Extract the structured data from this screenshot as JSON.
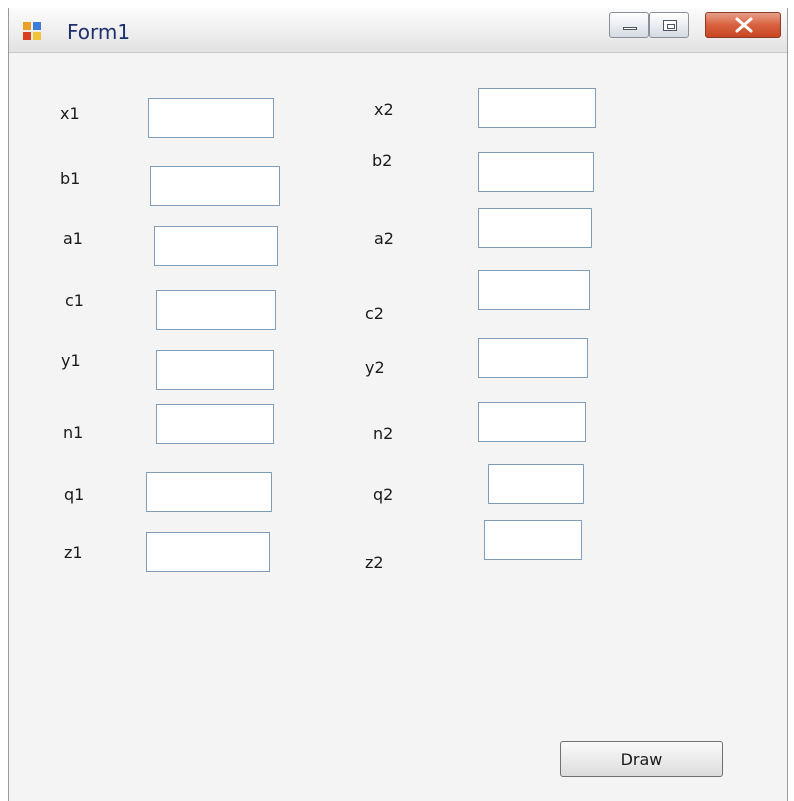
{
  "window": {
    "title": "Form1"
  },
  "fields": {
    "x1": {
      "label": "x1",
      "value": ""
    },
    "b1": {
      "label": "b1",
      "value": ""
    },
    "a1": {
      "label": "a1",
      "value": ""
    },
    "c1": {
      "label": "c1",
      "value": ""
    },
    "y1": {
      "label": "y1",
      "value": ""
    },
    "n1": {
      "label": "n1",
      "value": ""
    },
    "q1": {
      "label": "q1",
      "value": ""
    },
    "z1": {
      "label": "z1",
      "value": ""
    },
    "x2": {
      "label": "x2",
      "value": ""
    },
    "b2": {
      "label": "b2",
      "value": ""
    },
    "a2": {
      "label": "a2",
      "value": ""
    },
    "c2": {
      "label": "c2",
      "value": ""
    },
    "y2": {
      "label": "y2",
      "value": ""
    },
    "n2": {
      "label": "n2",
      "value": ""
    },
    "q2": {
      "label": "q2",
      "value": ""
    },
    "z2": {
      "label": "z2",
      "value": ""
    }
  },
  "buttons": {
    "draw": "Draw"
  }
}
